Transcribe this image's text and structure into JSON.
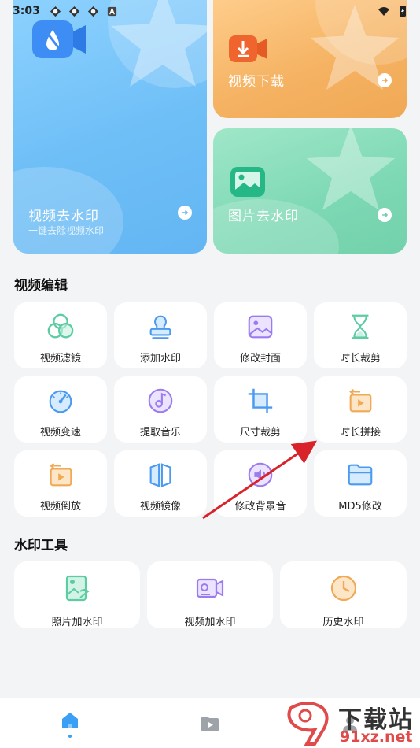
{
  "status_bar": {
    "time": "3:03"
  },
  "hero": {
    "video_remove": {
      "title": "视频去水印",
      "subtitle": "一键去除视频水印"
    },
    "video_download": {
      "title": "视频下载"
    },
    "image_remove": {
      "title": "图片去水印"
    }
  },
  "sections": {
    "video_edit": "视频编辑",
    "watermark_tools": "水印工具"
  },
  "video_tools": [
    {
      "label": "视频滤镜",
      "icon": "filter-circles-icon"
    },
    {
      "label": "添加水印",
      "icon": "stamp-icon"
    },
    {
      "label": "修改封面",
      "icon": "image-frame-icon"
    },
    {
      "label": "时长裁剪",
      "icon": "hourglass-icon"
    },
    {
      "label": "视频变速",
      "icon": "speedometer-icon"
    },
    {
      "label": "提取音乐",
      "icon": "music-disc-icon"
    },
    {
      "label": "尺寸裁剪",
      "icon": "crop-icon"
    },
    {
      "label": "时长拼接",
      "icon": "clip-join-icon"
    },
    {
      "label": "视频倒放",
      "icon": "reverse-play-icon"
    },
    {
      "label": "视频镜像",
      "icon": "mirror-icon"
    },
    {
      "label": "修改背景音",
      "icon": "speaker-icon"
    },
    {
      "label": "MD5修改",
      "icon": "folder-icon"
    }
  ],
  "watermark_tools": [
    {
      "label": "照片加水印",
      "icon": "photo-watermark-icon"
    },
    {
      "label": "视频加水印",
      "icon": "video-watermark-icon"
    },
    {
      "label": "历史水印",
      "icon": "history-clock-icon"
    }
  ],
  "watermark_overlay": {
    "brand": "下载站",
    "domain": "91xz.net"
  },
  "colors": {
    "accent_blue": "#3aa0f5",
    "hero_blue": "#6fbff7",
    "hero_orange": "#f5b262",
    "hero_green": "#7dd8b4",
    "annotation_red": "#d8232a"
  }
}
